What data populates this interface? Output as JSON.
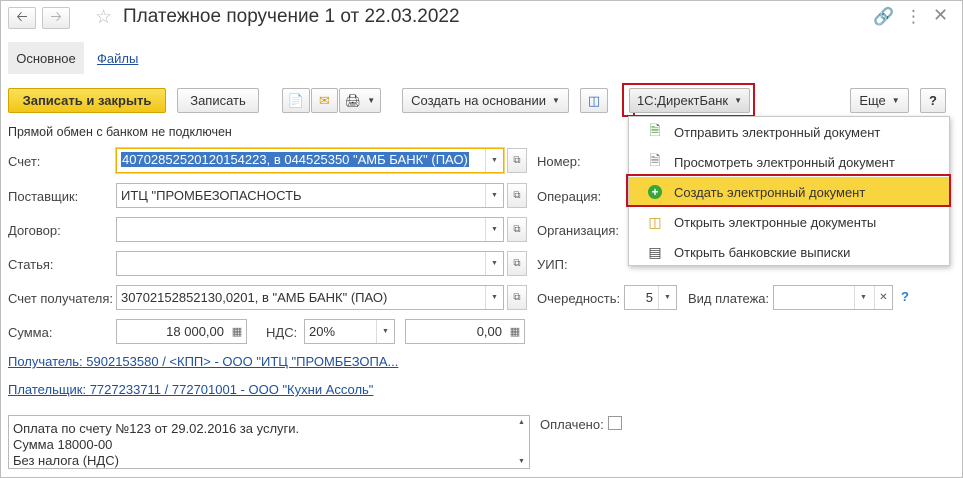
{
  "window": {
    "title": "Платежное поручение 1 от 22.03.2022",
    "back_icon": "arrow-left-icon",
    "forward_icon": "arrow-right-icon"
  },
  "tabs": [
    {
      "label": "Основное",
      "active": true
    },
    {
      "label": "Файлы",
      "active": false
    }
  ],
  "toolbar": {
    "save_close_label": "Записать и закрыть",
    "save_label": "Записать",
    "create_based_label": "Создать на основании",
    "directbank_label": "1С:ДиректБанк",
    "more_label": "Еще",
    "help_label": "?"
  },
  "status_text": "Прямой обмен с банком не подключен",
  "form": {
    "account_label": "Счет:",
    "account_value": "40702852520120154223, в 044525350 \"АМБ БАНК\" (ПАО)",
    "supplier_label": "Поставщик:",
    "supplier_value": "ИТЦ \"ПРОМБЕЗОПАСНОСТЬ",
    "contract_label": "Договор:",
    "contract_value": "",
    "article_label": "Статья:",
    "article_value": "",
    "recipient_account_label": "Счет получателя:",
    "recipient_account_value": "30702152852130,0201, в \"АМБ БАНК\" (ПАО)",
    "amount_label": "Сумма:",
    "amount_value": "18 000,00",
    "vat_label": "НДС:",
    "vat_rate": "20%",
    "vat_amount": "0,00",
    "number_label": "Номер:",
    "operation_label": "Операция:",
    "organization_label": "Организация:",
    "uip_label": "УИП:",
    "priority_label": "Очередность:",
    "priority_value": "5",
    "payment_type_label": "Вид платежа:",
    "payment_type_value": "",
    "paid_label": "Оплачено:",
    "paid_checked": false
  },
  "links": {
    "recipient": "Получатель: 5902153580 / <КПП> - ООО \"ИТЦ \"ПРОМБЕЗОПА...",
    "payer": "Плательщик: 7727233711 / 772701001 - ООО \"Кухни Ассоль\""
  },
  "purpose_lines": [
    "Оплата по счету №123 от 29.02.2016 за услуги.",
    "Сумма 18000-00",
    "Без налога (НДС)"
  ],
  "directbank_menu": [
    {
      "label": "Отправить электронный документ",
      "icon": "send-document-icon",
      "highlighted": false
    },
    {
      "label": "Просмотреть электронный документ",
      "icon": "document-icon",
      "highlighted": false
    },
    {
      "label": "Создать электронный документ",
      "icon": "add-green-icon",
      "highlighted": true
    },
    {
      "label": "Открыть электронные документы",
      "icon": "tree-structure-icon",
      "highlighted": false
    },
    {
      "label": "Открыть банковские выписки",
      "icon": "statement-icon",
      "highlighted": false
    }
  ],
  "colors": {
    "primary_button": "#f1c618",
    "highlight": "#f8d43f",
    "annotation_red": "#c1121f",
    "link": "#1f4f9c"
  }
}
